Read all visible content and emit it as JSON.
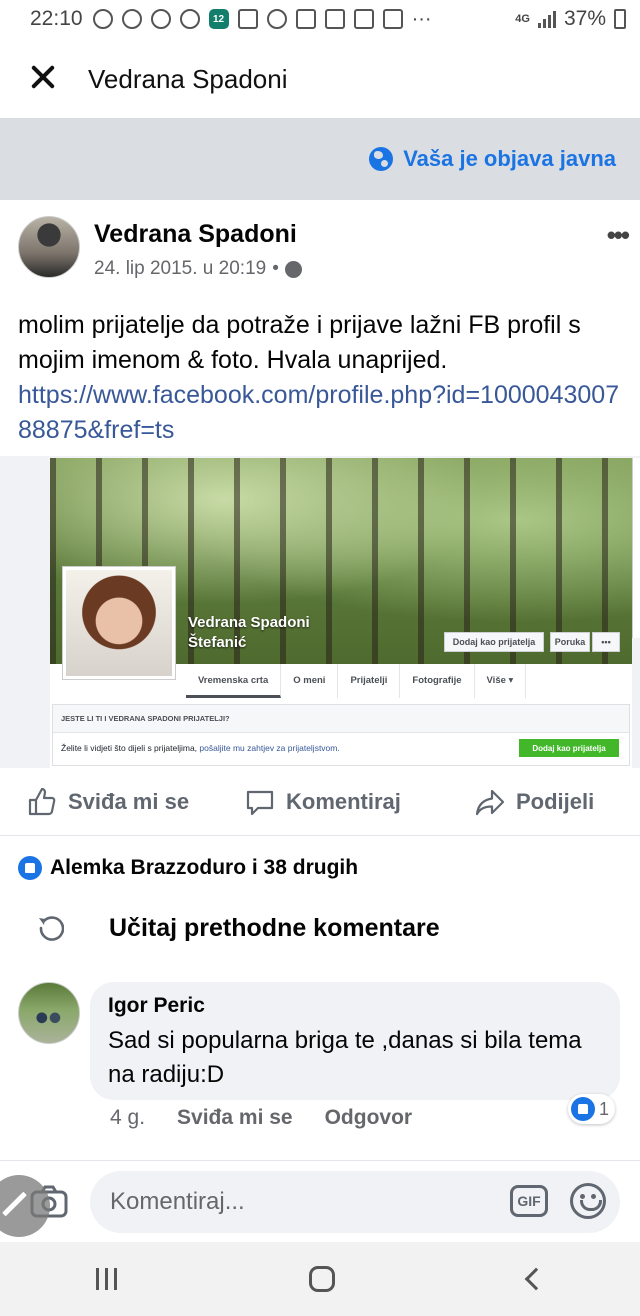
{
  "status_bar": {
    "time": "22:10",
    "network": "4G",
    "battery": "37%",
    "notification_badge": "12",
    "more": "···"
  },
  "header": {
    "title": "Vedrana Spadoni"
  },
  "privacy_banner": {
    "text": "Vaša je objava javna"
  },
  "post": {
    "author": "Vedrana Spadoni",
    "timestamp": "24. lip 2015. u 20:19",
    "separator": "•",
    "text": "molim prijatelje da potraže i prijave lažni FB profil s mojim imenom & foto. Hvala unaprijed.",
    "link": "https://www.facebook.com/profile.php?id=100004300788875&fref=ts",
    "preview": {
      "profile_name_line1": "Vedrana Spadoni",
      "profile_name_line2": "Štefanić",
      "add_friend_label": "Dodaj kao prijatelja",
      "message_label": "Poruka",
      "more_label": "•••",
      "tabs": [
        "Vremenska crta",
        "O meni",
        "Prijatelji",
        "Fotografije",
        "Više ▾"
      ],
      "box_heading": "JESTE LI TI I VEDRANA SPADONI PRIJATELJI?",
      "box_text": "Želite li vidjeti što dijeli s prijateljima, ",
      "box_link": "pošaljite mu zahtjev za prijateljstvom.",
      "box_button": "Dodaj kao prijatelja"
    }
  },
  "actions": {
    "like": "Sviđa mi se",
    "comment": "Komentiraj",
    "share": "Podijeli"
  },
  "reactions": {
    "summary": "Alemka Brazzoduro i 38 drugih"
  },
  "load_previous": {
    "label": "Učitaj prethodne komentare"
  },
  "comment": {
    "author": "Igor Peric",
    "text": "Sad si popularna briga te ,danas si bila tema na radiju:D",
    "age": "4 g.",
    "like_label": "Sviđa mi se",
    "reply_label": "Odgovor",
    "reaction_count": "1"
  },
  "composer": {
    "placeholder": "Komentiraj...",
    "gif_label": "GIF"
  },
  "colors": {
    "brand_blue": "#1b74e4",
    "link_blue": "#385898",
    "banner_bg": "#dadde1",
    "bubble_bg": "#f0f2f5"
  }
}
